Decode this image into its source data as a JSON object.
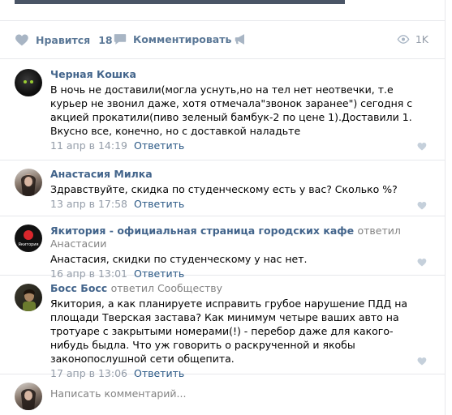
{
  "post_actions": {
    "like_label": "Нравится",
    "like_count": "18",
    "comment_label": "Комментировать",
    "views": "1K"
  },
  "comments": [
    {
      "author": "Черная Кошка",
      "reply_to": "",
      "text": "В ночь не доставили(могла уснуть,но на тел нет неотвечки, т.е курьер не звонил даже, хотя отмечала\"звонок заранее\") сегодня с акцией прокатили(пиво зеленый бамбук-2 по цене 1).Доставили 1. Вкусно все, конечно, но с доставкой наладьте",
      "date": "11 апр в 14:19",
      "reply_label": "Ответить"
    },
    {
      "author": "Анастасия Милка",
      "reply_to": "",
      "text": "Здравствуйте, скидка по студенческому есть у вас? Сколько %?",
      "date": "13 апр в 17:58",
      "reply_label": "Ответить"
    },
    {
      "author": "Якитория - официальная страница городских кафе",
      "reply_to": "ответил Анастасии",
      "text": "Анастасия, скидки по студенческому у нас нет.",
      "date": "16 апр в 13:01",
      "reply_label": "Ответить",
      "avatar_text": "Якитория"
    },
    {
      "author": "Босс Босс",
      "reply_to": "ответил Сообществу",
      "text": "Якитория, а как планируете исправить грубое нарушение ПДД на площади Тверская застава? Как минимум четыре ваших авто на тротуаре с закрытыми номерами(!) - перебор даже для какого-нибудь быдла. Что уж говорить о раскрученной и якобы законопослушной сети общепита.",
      "date": "17 апр в 13:06",
      "reply_label": "Ответить"
    }
  ],
  "composer": {
    "placeholder": "Написать комментарий..."
  },
  "colors": {
    "link": "#42648b",
    "action": "#5b7897",
    "muted": "#939ca8",
    "divider": "#e7e8ec"
  }
}
